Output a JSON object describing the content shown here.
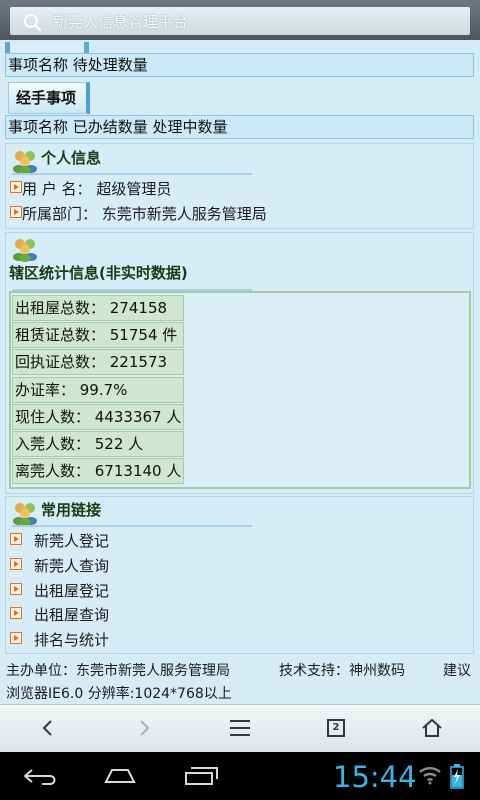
{
  "browser": {
    "url_title": "新莞人信息管理平台"
  },
  "pending": {
    "header": "事项名称 待处理数量"
  },
  "handled": {
    "tab_label": "经手事项",
    "header": "事项名称 已办结数量 处理中数量"
  },
  "personal": {
    "title": "个人信息",
    "rows": [
      {
        "label": "用 户 名：",
        "value": "超级管理员"
      },
      {
        "label": "所属部门：",
        "value": "东莞市新莞人服务管理局"
      }
    ]
  },
  "stats": {
    "title": "辖区统计信息(非实时数据)",
    "rows": [
      "出租屋总数： 274158 件",
      "租赁证总数： 51754 件",
      "回执证总数： 221573 件",
      "办证率： 99.7%",
      "现住人数： 4433367 人",
      "入莞人数： 522 人",
      "离莞人数： 6713140 人"
    ]
  },
  "links": {
    "title": "常用链接",
    "items": [
      "新莞人登记",
      "新莞人查询",
      "出租屋登记",
      "出租屋查询",
      "排名与统计"
    ]
  },
  "footer": {
    "host": "主办单位：东莞市新莞人服务管理局",
    "support": "技术支持：神州数码",
    "suggest": "建议",
    "browser_note": "浏览器IE6.0 分辨率:1024*768以上"
  },
  "toolbar": {
    "tab_count": "2"
  },
  "system": {
    "clock": "15:44"
  },
  "colors": {
    "accent": "#37b5e6",
    "panel_bg": "#d6ecf6",
    "arrow": "#e0702a"
  }
}
